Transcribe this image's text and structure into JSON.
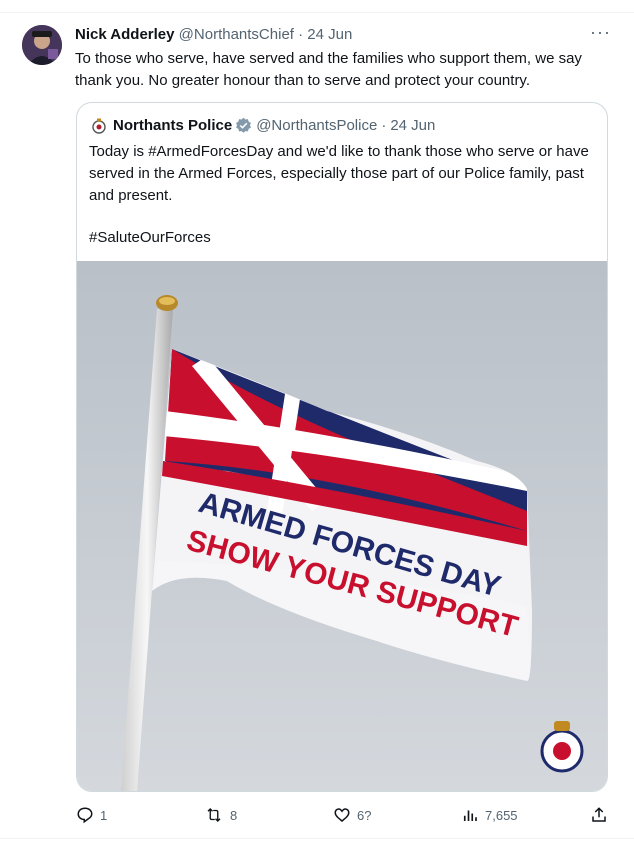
{
  "tweet": {
    "author_name": "Nick Adderley",
    "author_handle": "@NorthantsChief",
    "separator": "·",
    "date": "24 Jun",
    "text": "To those who serve, have served and the families who support them, we say thank you. No greater honour than to serve and protect your country.",
    "more_icon": "more-dots-icon"
  },
  "quoted_tweet": {
    "author_name": "Northants Police",
    "author_handle": "@NorthantsPolice",
    "separator": "·",
    "date": "24 Jun",
    "text_line1": "Today is #ArmedForcesDay and we'd like to thank those who serve or have served in the Armed Forces, especially those part of our Police family, past and present.",
    "hashtag": "#SaluteOurForces",
    "image": {
      "flag_line1": "ARMED FORCES DAY",
      "flag_line2": "SHOW YOUR SUPPORT"
    }
  },
  "actions": {
    "replies": "1",
    "reposts": "8",
    "likes": "6?",
    "views": "7,655"
  },
  "colors": {
    "text": "#0f1419",
    "muted": "#536471",
    "border": "#cfd9de",
    "verified": "#829aab",
    "flag_red": "#c8102e",
    "flag_blue": "#1f2a6b"
  }
}
